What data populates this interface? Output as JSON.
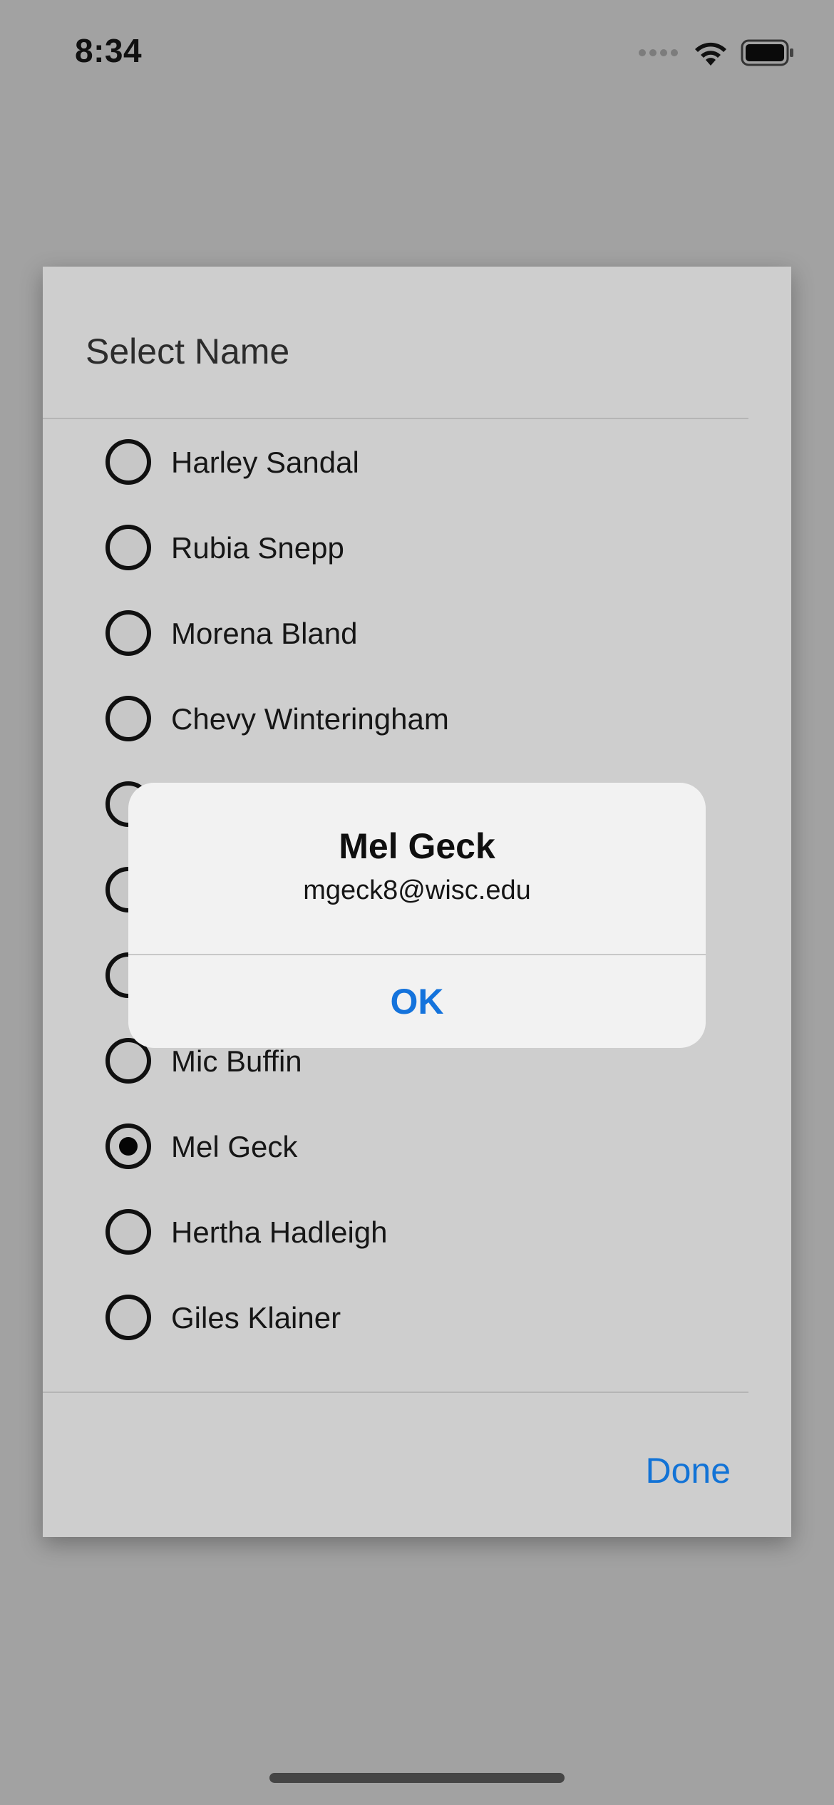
{
  "status_bar": {
    "time": "8:34",
    "icons": [
      "signal-icon",
      "wifi-icon",
      "battery-icon"
    ]
  },
  "dialog": {
    "title": "Select Name",
    "items": [
      {
        "label": "Harley Sandal",
        "selected": false
      },
      {
        "label": "Rubia Snepp",
        "selected": false
      },
      {
        "label": "Morena Bland",
        "selected": false
      },
      {
        "label": "Chevy Winteringham",
        "selected": false
      },
      {
        "label": "",
        "selected": false
      },
      {
        "label": "",
        "selected": false
      },
      {
        "label": "",
        "selected": false
      },
      {
        "label": "Mic Buffin",
        "selected": false
      },
      {
        "label": "Mel Geck",
        "selected": true
      },
      {
        "label": "Hertha Hadleigh",
        "selected": false
      },
      {
        "label": "Giles Klainer",
        "selected": false
      }
    ],
    "done_label": "Done"
  },
  "alert": {
    "title": "Mel Geck",
    "message": "mgeck8@wisc.edu",
    "ok_label": "OK"
  },
  "colors": {
    "accent": "#1473dc",
    "backdrop": "#a2a2a2",
    "dialog_bg": "#cecece",
    "alert_bg": "#f2f2f2"
  }
}
